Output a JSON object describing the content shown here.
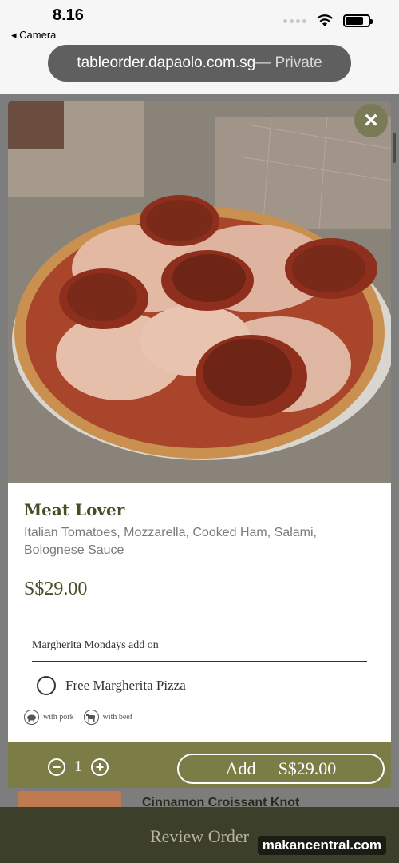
{
  "status_bar": {
    "time": "8.16",
    "back_app": "◂ Camera",
    "icons": [
      "signal-dots-icon",
      "wifi-icon",
      "battery-icon"
    ]
  },
  "browser": {
    "domain": "tableorder.dapaolo.com.sg",
    "private_label": " — Private"
  },
  "modal": {
    "close_icon": "close-icon",
    "item": {
      "name": "Meat Lover",
      "description": "Italian Tomatoes, Mozzarella, Cooked Ham, Salami, Bolognese Sauce",
      "price": "S$29.00"
    },
    "addon": {
      "heading": "Margherita Mondays add on",
      "options": [
        {
          "label": "Free Margherita Pizza",
          "selected": false
        }
      ]
    },
    "legend": [
      {
        "icon": "pig-icon",
        "label": "with pork"
      },
      {
        "icon": "cow-icon",
        "label": "with beef"
      }
    ],
    "quantity": "1",
    "add_label": "Add",
    "add_price": "S$29.00"
  },
  "background_page": {
    "item_title": "Cinnamon Croissant Knot",
    "review_label": "Review Order"
  },
  "watermark": "makancentral.com",
  "colors": {
    "brand_olive": "#7b7c46",
    "heading_olive": "#4a4d26",
    "bottom_bar": "#3c3f2a"
  }
}
